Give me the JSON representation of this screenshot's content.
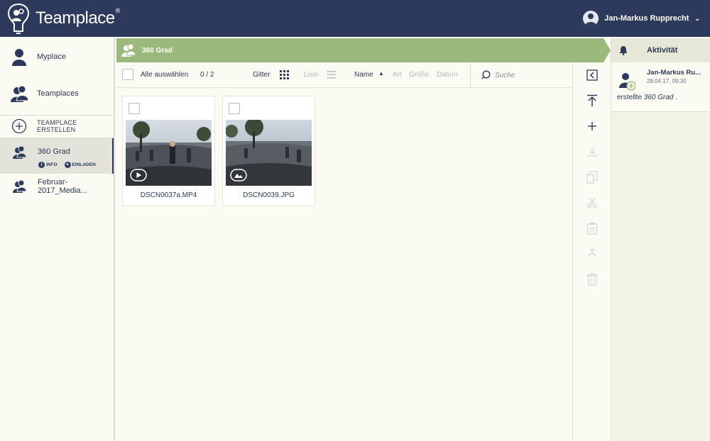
{
  "app": {
    "brand": "Teamplace",
    "brand_mark": "®",
    "user_name": "Jan-Markus Rupprecht"
  },
  "sidebar": {
    "items": [
      {
        "label": "Myplace",
        "icon": "person-icon"
      },
      {
        "label": "Teamplaces",
        "icon": "people-icon"
      },
      {
        "label": "TEAMPLACE ERSTELLEN",
        "icon": "plus-circle-icon"
      },
      {
        "label": "360 Grad",
        "icon": "team-icon",
        "active": true
      },
      {
        "label": "Februar-2017_Media...",
        "icon": "team-icon"
      }
    ],
    "sub_actions": {
      "info": "INFO",
      "invite": "EINLADEN"
    }
  },
  "breadcrumb": {
    "title": "360 Grad"
  },
  "toolbar": {
    "select_all": "Alle auswählen",
    "count": "0 / 2",
    "view_grid": "Gitter",
    "view_list": "Liste",
    "sort_name": "Name",
    "sort_type": "Art",
    "sort_size": "Größe",
    "sort_date": "Datum",
    "search_placeholder": "Suche"
  },
  "files": [
    {
      "name": "DSCN0037a.MP4",
      "kind": "video"
    },
    {
      "name": "DSCN0039.JPG",
      "kind": "image"
    }
  ],
  "activity": {
    "title": "Aktivität",
    "entries": [
      {
        "user": "Jan-Markus Ru...",
        "time": "28.04.17, 09:30",
        "action": "erstellte",
        "target": "360 Grad",
        "suffix": "."
      }
    ]
  },
  "colors": {
    "header_bg": "#2d3a5c",
    "accent_green": "#9bb97c",
    "background": "#fbfbf3"
  }
}
